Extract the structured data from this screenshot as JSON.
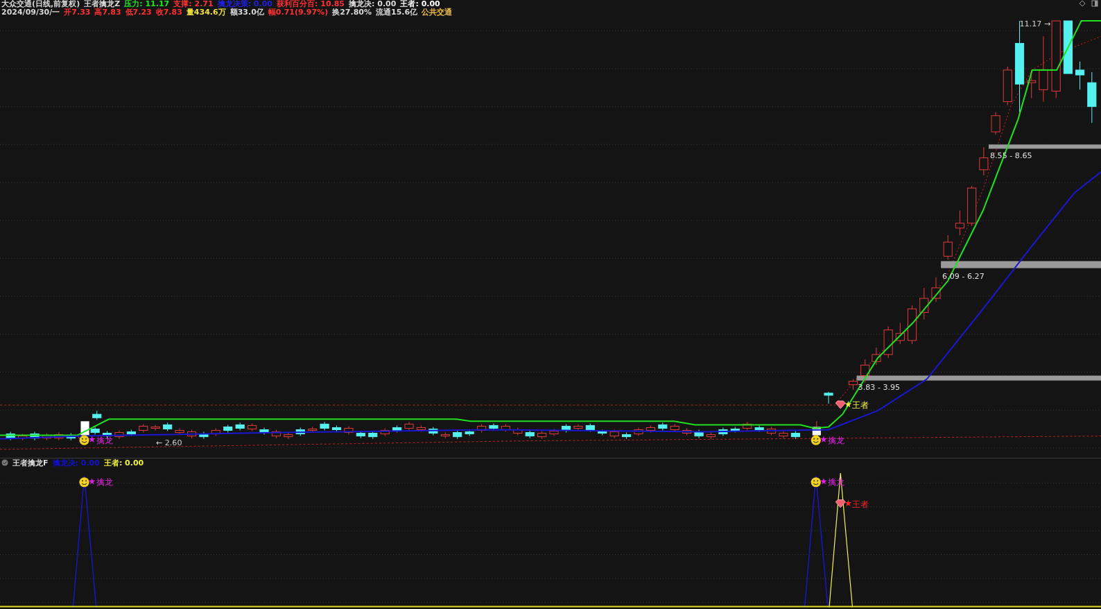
{
  "header": {
    "line1": [
      {
        "text": "大众交通(日线,前复权)",
        "color": "#d8d8d8"
      },
      {
        "text": "王者擒龙Z",
        "color": "#d8d8d8"
      },
      {
        "text": "压力: 11.17",
        "color": "#22e022"
      },
      {
        "text": "支撑: 2.71",
        "color": "#ff3030"
      },
      {
        "text": "擒龙决策: 0.00",
        "color": "#2020e0"
      },
      {
        "text": "获利百分百: 10.85",
        "color": "#ff3030"
      },
      {
        "text": "擒龙决: 0.00",
        "color": "#d8d8d8"
      },
      {
        "text": "王者: 0.00",
        "color": "#ffffff"
      }
    ],
    "line2": [
      {
        "text": "2024/09/30/一",
        "color": "#d8d8d8"
      },
      {
        "text": "开7.33",
        "color": "#ff3030"
      },
      {
        "text": "高7.83",
        "color": "#ff3030"
      },
      {
        "text": "低7.23",
        "color": "#ff3030"
      },
      {
        "text": "收7.83",
        "color": "#ff3030"
      },
      {
        "text": "量434.6万",
        "color": "#f0e040"
      },
      {
        "text": "额33.0亿",
        "color": "#d8d8d8"
      },
      {
        "text": "幅0.71(9.97%)",
        "color": "#ff3030"
      },
      {
        "text": "换27.80%",
        "color": "#d8d8d8"
      },
      {
        "text": "流通15.6亿",
        "color": "#d8d8d8"
      },
      {
        "text": "公共交通",
        "color": "#f0c040"
      }
    ]
  },
  "main_chart": {
    "low_mark": "← 2.60",
    "high_mark": "11.17 →",
    "zones": [
      "3.83 - 3.95",
      "6.09 - 6.27",
      "8.55 - 8.65"
    ],
    "signals": [
      {
        "kind": "dragon",
        "text": "擒龙"
      },
      {
        "kind": "dragon",
        "text": "擒龙"
      },
      {
        "kind": "king",
        "text": "王者"
      }
    ]
  },
  "sub_panel": {
    "title": "王者擒龙F",
    "items": [
      {
        "text": "擒龙决: 0.00",
        "color": "#1010d0"
      },
      {
        "text": "王者: 0.00",
        "color": "#f0f040"
      }
    ],
    "signals": [
      {
        "kind": "dragon",
        "text": "擒龙"
      },
      {
        "kind": "dragon",
        "text": "擒龙"
      },
      {
        "kind": "king",
        "text": "王者"
      }
    ]
  }
}
